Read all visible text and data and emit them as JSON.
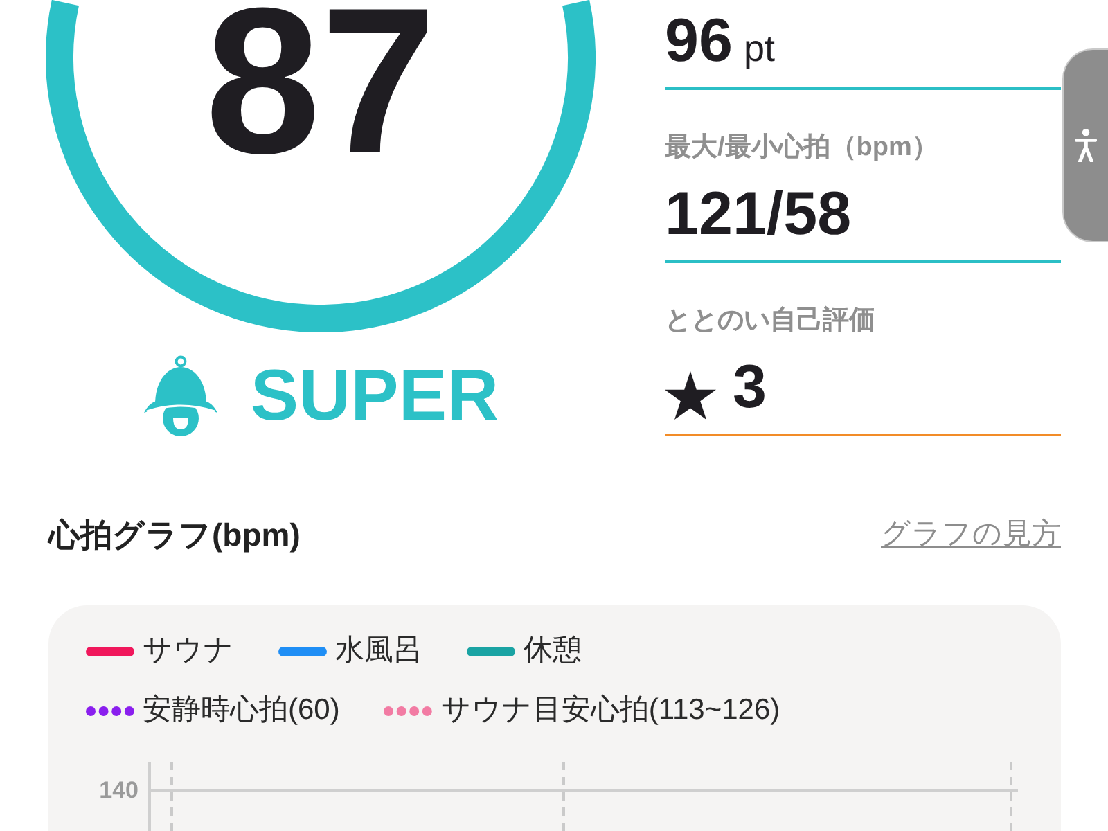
{
  "score": {
    "value": "87",
    "rank": "SUPER"
  },
  "stats": [
    {
      "kind": "points",
      "value": "96",
      "unit": "pt",
      "color": "#2bbfc6"
    },
    {
      "kind": "range",
      "label": "最大/最小心拍（bpm）",
      "value": "121/58",
      "color": "#2bbfc6"
    },
    {
      "kind": "rating",
      "label": "ととのい自己評価",
      "value": "3",
      "color": "#f28c28"
    }
  ],
  "heart_rate_graph": {
    "title": "心拍グラフ(bpm)",
    "help_link": "グラフの見方",
    "legend_rows": [
      [
        {
          "kind": "line",
          "label": "サウナ",
          "color": "#f0175b"
        },
        {
          "kind": "line",
          "label": "水風呂",
          "color": "#1f8ef5"
        },
        {
          "kind": "line",
          "label": "休憩",
          "color": "#1aa3a3"
        }
      ],
      [
        {
          "kind": "dotted",
          "label": "安静時心拍(60)",
          "color": "#8a1fee"
        },
        {
          "kind": "dotted",
          "label": "サウナ目安心拍(113~126)",
          "color": "#f27ba3"
        }
      ]
    ],
    "y_tick_labels": [
      "140"
    ]
  }
}
